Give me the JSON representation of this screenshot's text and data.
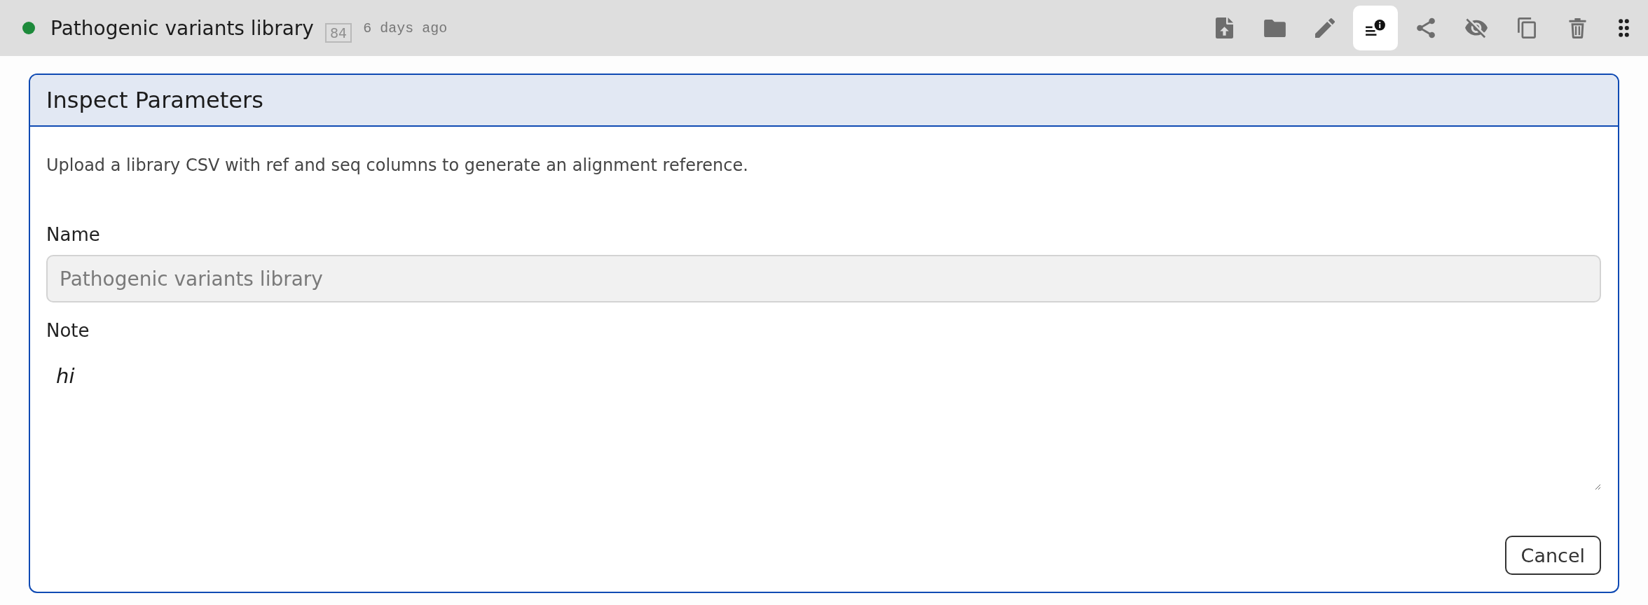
{
  "header": {
    "status_dot": {
      "color": "#1d8a3b"
    },
    "title": "Pathogenic variants library",
    "badge": "84",
    "timestamp": "6 days ago",
    "toolbar": [
      {
        "kind": "upload",
        "selected": false
      },
      {
        "kind": "folder",
        "selected": false
      },
      {
        "kind": "edit",
        "selected": false
      },
      {
        "kind": "details",
        "selected": true
      },
      {
        "kind": "share",
        "selected": false
      },
      {
        "kind": "hide",
        "selected": false
      },
      {
        "kind": "copy",
        "selected": false
      },
      {
        "kind": "delete",
        "selected": false
      },
      {
        "kind": "grip",
        "selected": false
      }
    ]
  },
  "panel": {
    "title": "Inspect Parameters",
    "description": "Upload a library CSV with ref and seq columns to generate an alignment reference.",
    "fields": [
      {
        "kind": "text",
        "label": "Name",
        "value": "Pathogenic variants library",
        "disabled": true
      },
      {
        "kind": "textarea",
        "label": "Note",
        "value": "hi",
        "disabled": false
      }
    ],
    "buttons": [
      {
        "label": "Cancel"
      }
    ]
  }
}
